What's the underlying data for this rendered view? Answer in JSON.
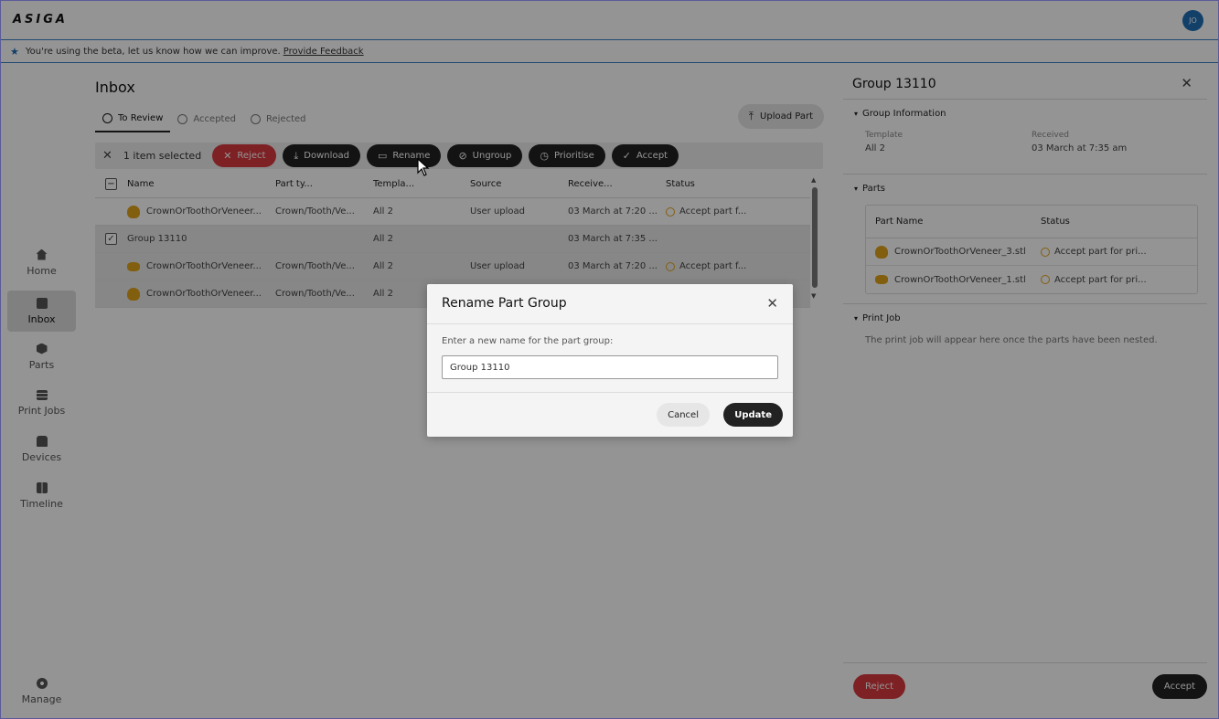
{
  "header": {
    "logo": "ASIGA",
    "avatar": "JO"
  },
  "beta_banner": {
    "text": "You're using the beta, let us know how we can improve.",
    "link": "Provide Feedback"
  },
  "sidebar": {
    "items": [
      {
        "label": "Home",
        "icon": "home-icon"
      },
      {
        "label": "Inbox",
        "icon": "inbox-icon",
        "active": true
      },
      {
        "label": "Parts",
        "icon": "cube-icon"
      },
      {
        "label": "Print Jobs",
        "icon": "stack-icon"
      },
      {
        "label": "Devices",
        "icon": "printer-icon"
      },
      {
        "label": "Timeline",
        "icon": "timeline-icon"
      }
    ],
    "manage": {
      "label": "Manage",
      "icon": "gear-icon"
    }
  },
  "main": {
    "title": "Inbox",
    "tabs": [
      {
        "label": "To Review",
        "active": true
      },
      {
        "label": "Accepted"
      },
      {
        "label": "Rejected"
      }
    ],
    "upload_label": "Upload Part",
    "actions": {
      "selection_text": "1 item selected",
      "reject": "Reject",
      "download": "Download",
      "rename": "Rename",
      "ungroup": "Ungroup",
      "prioritise": "Prioritise",
      "accept": "Accept"
    },
    "table": {
      "headers": [
        "Name",
        "Part ty...",
        "Templa...",
        "Source",
        "Receive...",
        "Status"
      ],
      "rows": [
        {
          "name": "CrownOrToothOrVeneer...",
          "type": "Crown/Tooth/Ve...",
          "template": "All 2",
          "source": "User upload",
          "received": "03 March at 7:20 ...",
          "status": "Accept part f...",
          "checkbox": false,
          "selected": false
        },
        {
          "name": "Group 13110",
          "type": "",
          "template": "All 2",
          "source": "",
          "received": "03 March at 7:35 ...",
          "status": "",
          "checkbox": true,
          "selected": true
        },
        {
          "name": "CrownOrToothOrVeneer...",
          "type": "Crown/Tooth/Ve...",
          "template": "All 2",
          "source": "User upload",
          "received": "03 March at 7:20 ...",
          "status": "Accept part f...",
          "checkbox": false,
          "selected": true
        },
        {
          "name": "CrownOrToothOrVeneer...",
          "type": "Crown/Tooth/Ve...",
          "template": "All 2",
          "source": "",
          "received": "",
          "status": "",
          "checkbox": false,
          "selected": true
        }
      ]
    }
  },
  "panel": {
    "title": "Group 13110",
    "group_info": {
      "heading": "Group Information",
      "template_label": "Template",
      "template_value": "All 2",
      "received_label": "Received",
      "received_value": "03 March at 7:35 am"
    },
    "parts": {
      "heading": "Parts",
      "col_name": "Part Name",
      "col_status": "Status",
      "rows": [
        {
          "name": "CrownOrToothOrVeneer_3.stl",
          "status": "Accept part for pri..."
        },
        {
          "name": "CrownOrToothOrVeneer_1.stl",
          "status": "Accept part for pri..."
        }
      ]
    },
    "print_job": {
      "heading": "Print Job",
      "note": "The print job will appear here once the parts have been nested."
    },
    "reject": "Reject",
    "accept": "Accept"
  },
  "modal": {
    "title": "Rename Part Group",
    "label": "Enter a new name for the part group:",
    "input_value": "Group 13110",
    "cancel": "Cancel",
    "update": "Update"
  },
  "colors": {
    "accent": "#1f6fb6",
    "reject": "#d9393f",
    "dark": "#222222",
    "status": "#e0a31a"
  }
}
